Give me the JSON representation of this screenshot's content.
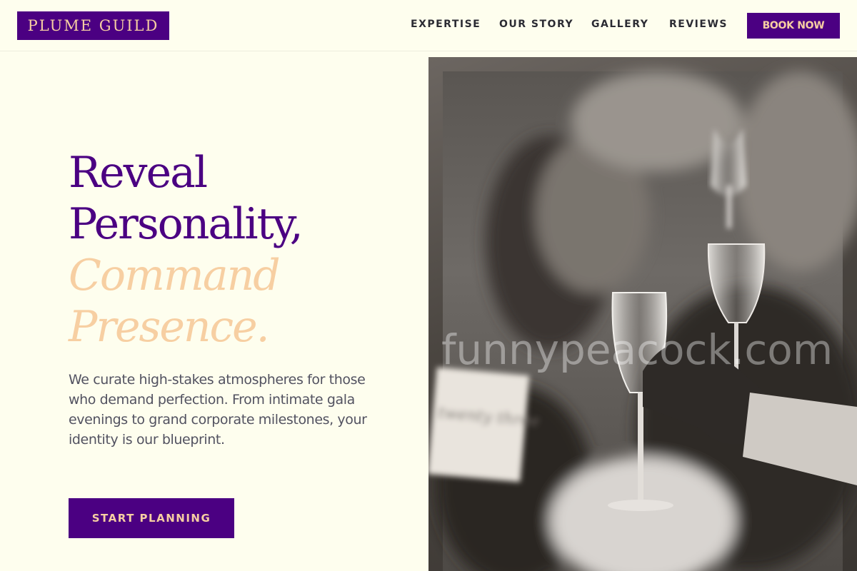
{
  "header": {
    "logo": "PLUME GUILD",
    "nav": [
      "EXPERTISE",
      "OUR STORY",
      "GALLERY",
      "REVIEWS"
    ],
    "book_label": "BOOK NOW"
  },
  "hero": {
    "headline": [
      "Reveal",
      "Personality,"
    ],
    "headline_accent": [
      "Command",
      "Presence."
    ],
    "lede": "We curate high-stakes atmospheres for those who demand perfection. From intimate gala evenings to grand corporate milestones, your identity is our blueprint.",
    "cta_label": "START PLANNING"
  },
  "image": {
    "watermark": "funnypeacock.com",
    "place_card_text": "twenty three"
  },
  "colors": {
    "brand_purple": "#4b0082",
    "accent_peach": "#f7cfa2",
    "page_background": "#fefeee",
    "body_text": "#525260"
  }
}
